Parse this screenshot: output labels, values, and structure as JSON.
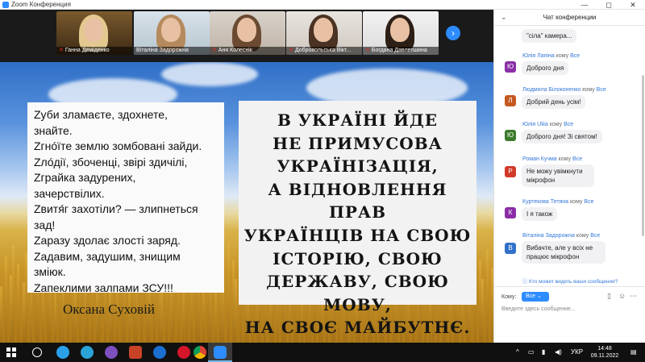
{
  "window": {
    "title": "Zoom Конференция",
    "controls": [
      "—",
      "◻",
      "✕"
    ]
  },
  "gallery": {
    "participants": [
      {
        "name": "Ганна Деміденко"
      },
      {
        "name": "Віталіна Задорожна"
      },
      {
        "name": "Аня Колеснік"
      },
      {
        "name": "Добровольська Вікт..."
      },
      {
        "name": "Богдана Давлетшина"
      }
    ],
    "next_arrow": "›"
  },
  "slide": {
    "poem_lines": [
      "Zуби зламаєте, здохнете,",
      "знайте.",
      "Zгнóїте землю зомбовані зайди.",
      "Zлóдії, збоченці, звірі здичілі,",
      "Zграйка задурених,",
      "зачерствілих.",
      "Zвитя́г захотіли? — злипнеться",
      "зад!",
      "Zаразу здолає злості заряд.",
      "Zадавим, задушим, знищим",
      "зміюк.",
      "Zапеклими залпами ЗСУ!!!"
    ],
    "author": "Оксана Суховій",
    "slogan_lines": [
      "В УКРАЇНІ ЙДЕ",
      "НЕ ПРИМУСОВА",
      "УКРАЇНІЗАЦІЯ,",
      "А ВІДНОВЛЕННЯ ПРАВ",
      "УКРАЇНЦІВ НА СВОЮ",
      "ІСТОРІЮ, СВОЮ",
      "ДЕРЖАВУ, СВОЮ МОВУ,",
      "НА СВОЄ МАЙБУТНЄ."
    ]
  },
  "chat": {
    "title": "Чат конференции",
    "collapse_icon": "⌄",
    "to_word": "кому",
    "everyone": "Все",
    "top_fragment": "\"сіла\" камера...",
    "messages": [
      {
        "initial": "Ю",
        "color": "#8a2da6",
        "sender": "Юлія Лапіна",
        "text": "Доброго дня"
      },
      {
        "initial": "Л",
        "color": "#c45a21",
        "sender": "Людмила Білоконенко",
        "text": "Добрий день усім!"
      },
      {
        "initial": "Ю",
        "color": "#3b7a2a",
        "sender": "Юлія Uliia",
        "text": "Доброго дня! Зі святом!"
      },
      {
        "initial": "Р",
        "color": "#d13a2a",
        "sender": "Роман Кучма",
        "text": "Не можу увімкнути мікрофон"
      },
      {
        "initial": "К",
        "color": "#8a2da6",
        "sender": "Куртекова Тетяна",
        "text": "І я також"
      },
      {
        "initial": "В",
        "color": "#3172c9",
        "sender": "Віталіна Задорожна",
        "text": "Вибачте, але у всіх не працює мікрофон"
      }
    ],
    "visibility_note": "Кто может видеть ваши сообщения?",
    "compose": {
      "to_label": "Кому:",
      "recipient": "Все",
      "placeholder": "Введите здесь сообщение..."
    }
  },
  "taskbar": {
    "tray_lang": "УКР",
    "time": "14:48",
    "date": "09.11.2022"
  }
}
